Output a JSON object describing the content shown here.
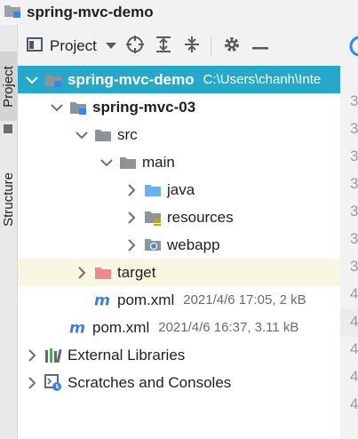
{
  "window": {
    "title": "spring-mvc-demo"
  },
  "side_tabs": {
    "project": "Project",
    "structure": "Structure"
  },
  "toolbar": {
    "view_label": "Project"
  },
  "tree": [
    {
      "label": "spring-mvc-demo",
      "meta": "C:\\Users\\chanh\\Inte",
      "icon": "module-folder-icon",
      "arrow": "down",
      "selected": true
    },
    {
      "label": "spring-mvc-03",
      "meta": "",
      "icon": "module-folder-icon",
      "arrow": "down",
      "bold": true
    },
    {
      "label": "src",
      "meta": "",
      "icon": "folder-icon",
      "arrow": "down"
    },
    {
      "label": "main",
      "meta": "",
      "icon": "folder-icon",
      "arrow": "down"
    },
    {
      "label": "java",
      "meta": "",
      "icon": "source-folder-icon",
      "arrow": "right"
    },
    {
      "label": "resources",
      "meta": "",
      "icon": "resources-folder-icon",
      "arrow": "right"
    },
    {
      "label": "webapp",
      "meta": "",
      "icon": "web-folder-icon",
      "arrow": "right"
    },
    {
      "label": "target",
      "meta": "",
      "icon": "excluded-folder-icon",
      "arrow": "right",
      "excluded": true
    },
    {
      "label": "pom.xml",
      "meta": "2021/4/6 17:05, 2 kB",
      "icon": "maven-icon",
      "arrow": "none"
    },
    {
      "label": "pom.xml",
      "meta": "2021/4/6 16:37, 3.11 kB",
      "icon": "maven-icon",
      "arrow": "none"
    },
    {
      "label": "External Libraries",
      "meta": "",
      "icon": "libraries-icon",
      "arrow": "right"
    },
    {
      "label": "Scratches and Consoles",
      "meta": "",
      "icon": "scratches-icon",
      "arrow": "right"
    }
  ],
  "editor_gutter": [
    "3",
    "3",
    "3",
    "3",
    "3",
    "3",
    "3",
    "4",
    "4",
    "4",
    "4",
    "4"
  ],
  "colors": {
    "selection": "#26a9c9",
    "excluded_row": "#f9f7e2",
    "excluded_folder": "#f08a8a",
    "source_folder": "#6bb0e8",
    "maven": "#3d7fd9"
  }
}
